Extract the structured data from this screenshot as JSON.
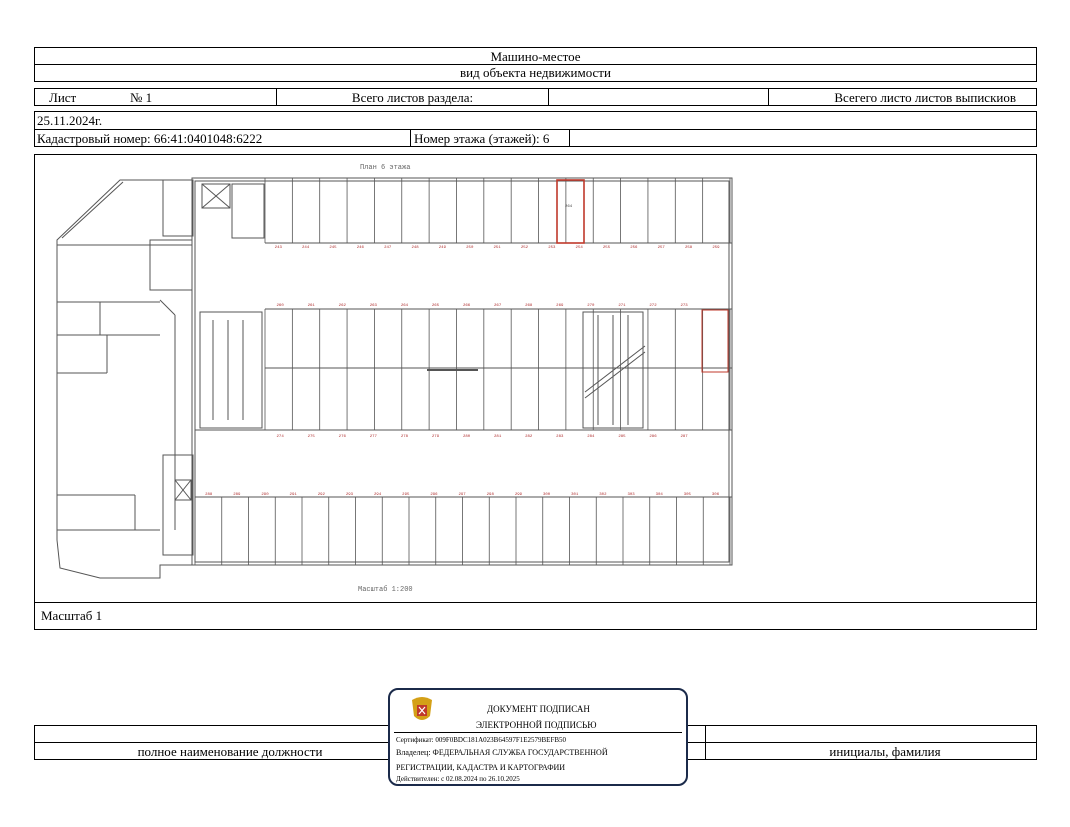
{
  "header": {
    "title": "Машино-местое",
    "object_type": "вид объекта недвижимости"
  },
  "sheet_row": {
    "sheet_label": "Лист",
    "sheet_number": "№ 1",
    "total_sheets_label": "Всего листов раздела:",
    "total_sheets_value": "",
    "total_extract_label": "Всегего листо листов выпискиов"
  },
  "meta": {
    "date": "25.11.2024г.",
    "cadastral": "Кадастровый номер: 66:41:0401048:6222",
    "floor": "Номер этажа (этажей): 6"
  },
  "plan": {
    "title": "План 6 этажа",
    "scale_caption": "Масштаб 1:200",
    "highlight_label": "264",
    "row1_numbers": [
      "243",
      "244",
      "245",
      "246",
      "247",
      "248",
      "249",
      "250",
      "251",
      "252",
      "253",
      "254",
      "255",
      "256",
      "257",
      "258",
      "259"
    ],
    "row2_numbers": [
      "260",
      "261",
      "262",
      "263",
      "264",
      "265",
      "266",
      "267",
      "268",
      "269",
      "270",
      "271",
      "272",
      "273"
    ],
    "row3_numbers": [
      "274",
      "275",
      "276",
      "277",
      "278",
      "279",
      "280",
      "281",
      "282",
      "283",
      "284",
      "285",
      "286",
      "287"
    ],
    "row4_numbers": [
      "288",
      "289",
      "290",
      "291",
      "292",
      "293",
      "294",
      "295",
      "296",
      "297",
      "298",
      "299",
      "300",
      "301",
      "302",
      "303",
      "304",
      "305",
      "306"
    ]
  },
  "scale_row": {
    "label": "Масштаб 1"
  },
  "signature": {
    "position_label": "полное наименование должности",
    "name_label": "инициалы, фамилия"
  },
  "stamp": {
    "line1": "ДОКУМЕНТ ПОДПИСАН",
    "line2": "ЭЛЕКТРОННОЙ ПОДПИСЬЮ",
    "certificate": "Сертификат: 009F0BDC181A023B64597F1E2579BEFB50",
    "owner1": "Владелец: ФЕДЕРАЛЬНАЯ СЛУЖБА ГОСУДАРСТВЕННОЙ",
    "owner2": "РЕГИСТРАЦИИ, КАДАСТРА И КАРТОГРАФИИ",
    "valid": "Действителен: с 02.08.2024 по 26.10.2025"
  },
  "colors": {
    "line": "#000000",
    "plan_line": "#555555",
    "highlight": "#c0392b",
    "stamp_border": "#1b2a4a"
  },
  "icons": {
    "stamp_emblem": "coat-of-arms-icon"
  }
}
